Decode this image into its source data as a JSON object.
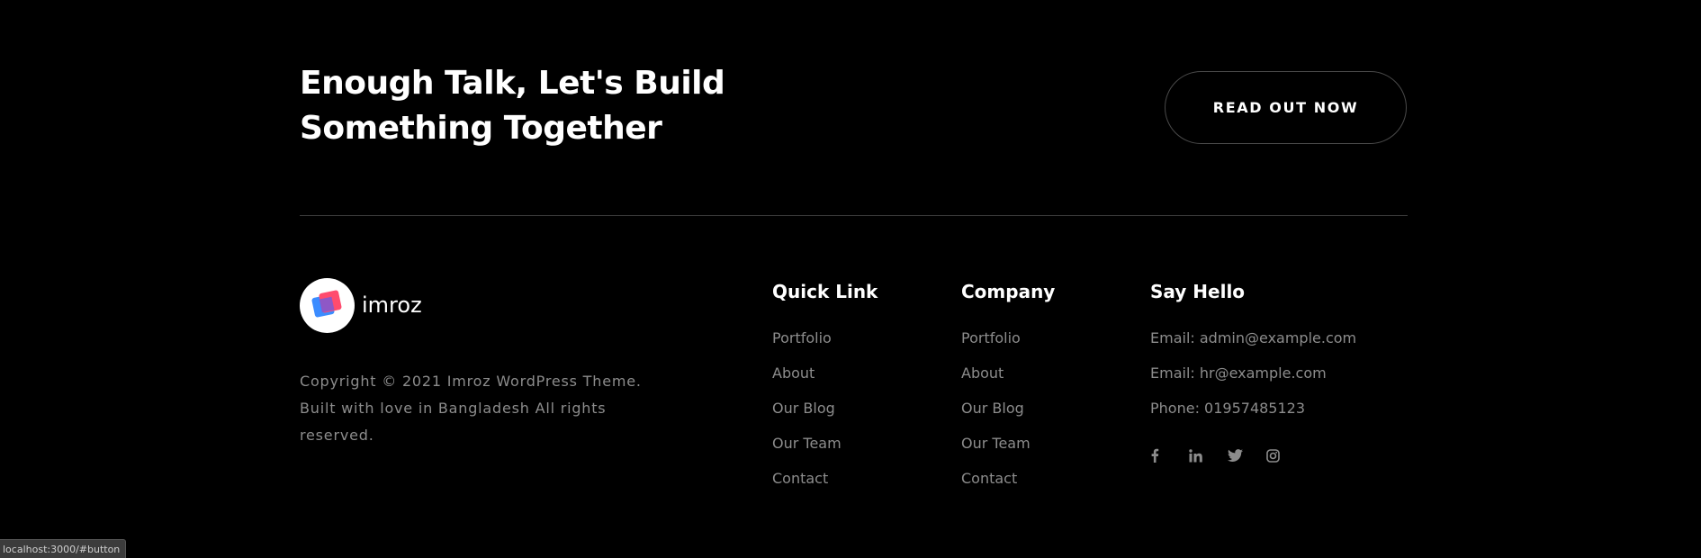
{
  "cta": {
    "heading_line1": "Enough Talk, Let's Build",
    "heading_line2": "Something Together",
    "button_label": "READ OUT NOW"
  },
  "brand": {
    "name": "imroz",
    "logo_colors": {
      "front": "#ff4b6e",
      "back": "#3b8cff"
    },
    "copyright": "Copyright © 2021 Imroz WordPress Theme. Built with love in Bangladesh All rights reserved."
  },
  "quick_links": {
    "title": "Quick Link",
    "items": [
      "Portfolio",
      "About",
      "Our Blog",
      "Our Team",
      "Contact"
    ]
  },
  "company": {
    "title": "Company",
    "items": [
      "Portfolio",
      "About",
      "Our Blog",
      "Our Team",
      "Contact"
    ]
  },
  "say_hello": {
    "title": "Say Hello",
    "lines": [
      "Email: admin@example.com",
      "Email: hr@example.com",
      "Phone: 01957485123"
    ],
    "socials": [
      "facebook-icon",
      "linkedin-icon",
      "twitter-icon",
      "instagram-icon"
    ]
  },
  "status_bar": {
    "url": "localhost:3000/#button"
  },
  "colors": {
    "background": "#000000",
    "heading": "#ffffff",
    "muted_text": "#8c8c8c",
    "divider": "#3a3a3a",
    "button_border": "#4a4a4a"
  }
}
